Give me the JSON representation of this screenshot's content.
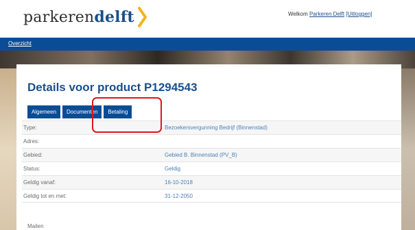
{
  "header": {
    "logo_part1": "parkeren",
    "logo_part2": "delft",
    "welcome_prefix": "Welkom ",
    "user_name": "Parkeren Delft",
    "logout_label": "[Uitloggen]"
  },
  "nav": {
    "overview_label": "Overzicht"
  },
  "main": {
    "title": "Details voor product P1294543",
    "tabs": [
      {
        "label": "Algemeen"
      },
      {
        "label": "Documenten"
      },
      {
        "label": "Betaling"
      }
    ],
    "rows": [
      {
        "label": "Type:",
        "value": "Bezoekersvergunning Bedrijf (Binnenstad)"
      },
      {
        "label": "Adres:",
        "value": ""
      },
      {
        "label": "Gebied:",
        "value": "Gebied B. Binnenstad (PV_B)"
      },
      {
        "label": "Status:",
        "value": "Geldig"
      },
      {
        "label": "Geldig vanaf:",
        "value": "16-10-2018"
      },
      {
        "label": "Geldig tot en met:",
        "value": "31-12-2050"
      }
    ],
    "footer_text": "Mailen"
  },
  "colors": {
    "brand_blue": "#0b4d95",
    "logo_chevron": "#f5b21a",
    "highlight_red": "#e0141b"
  }
}
